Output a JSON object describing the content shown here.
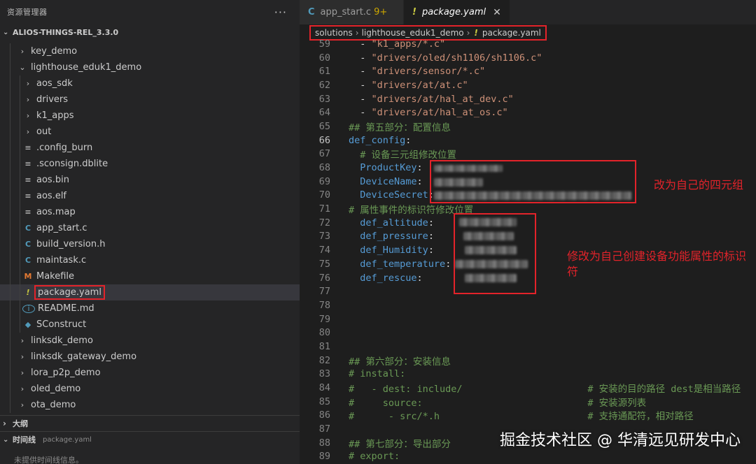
{
  "sidebar": {
    "title": "资源管理器",
    "more": "···",
    "project": "ALIOS-THINGS-REL_3.3.0",
    "tree": [
      {
        "label": "key_demo",
        "icon": "chevron-right",
        "indent": 1
      },
      {
        "label": "lighthouse_eduk1_demo",
        "icon": "chevron-down",
        "indent": 1
      },
      {
        "label": "aos_sdk",
        "icon": "chevron-right",
        "indent": 2
      },
      {
        "label": "drivers",
        "icon": "chevron-right",
        "indent": 2
      },
      {
        "label": "k1_apps",
        "icon": "chevron-right",
        "indent": 2
      },
      {
        "label": "out",
        "icon": "chevron-right",
        "indent": 2
      },
      {
        "label": ".config_burn",
        "icon": "lines",
        "indent": 2
      },
      {
        "label": ".sconsign.dblite",
        "icon": "lines",
        "indent": 2
      },
      {
        "label": "aos.bin",
        "icon": "lines",
        "indent": 2
      },
      {
        "label": "aos.elf",
        "icon": "lines",
        "indent": 2
      },
      {
        "label": "aos.map",
        "icon": "lines",
        "indent": 2
      },
      {
        "label": "app_start.c",
        "icon": "c",
        "indent": 2
      },
      {
        "label": "build_version.h",
        "icon": "c",
        "indent": 2
      },
      {
        "label": "maintask.c",
        "icon": "c",
        "indent": 2
      },
      {
        "label": "Makefile",
        "icon": "m",
        "indent": 2
      },
      {
        "label": "package.yaml",
        "icon": "exclaim",
        "indent": 2,
        "active": true
      },
      {
        "label": "README.md",
        "icon": "info",
        "indent": 2
      },
      {
        "label": "SConstruct",
        "icon": "s",
        "indent": 2
      },
      {
        "label": "linksdk_demo",
        "icon": "chevron-right",
        "indent": 1
      },
      {
        "label": "linksdk_gateway_demo",
        "icon": "chevron-right",
        "indent": 1
      },
      {
        "label": "lora_p2p_demo",
        "icon": "chevron-right",
        "indent": 1
      },
      {
        "label": "oled_demo",
        "icon": "chevron-right",
        "indent": 1
      },
      {
        "label": "ota_demo",
        "icon": "chevron-right",
        "indent": 1
      }
    ],
    "outline_label": "大纲",
    "timeline_label": "时间线",
    "timeline_file": "package.yaml",
    "timeline_empty": "未提供时间线信息。"
  },
  "tabs": [
    {
      "name": "app_start.c",
      "icon": "c",
      "modified": "9+",
      "active": false
    },
    {
      "name": "package.yaml",
      "icon": "exclaim",
      "active": true,
      "close": "✕"
    }
  ],
  "breadcrumb": [
    "solutions",
    "lighthouse_eduk1_demo",
    "package.yaml"
  ],
  "code_lines": [
    {
      "n": "59",
      "parts": [
        [
          "t",
          "  - "
        ],
        [
          "st",
          "\"k1_apps/*.c\""
        ]
      ]
    },
    {
      "n": "60",
      "parts": [
        [
          "t",
          "  - "
        ],
        [
          "st",
          "\"drivers/oled/sh1106/sh1106.c\""
        ]
      ]
    },
    {
      "n": "61",
      "parts": [
        [
          "t",
          "  - "
        ],
        [
          "st",
          "\"drivers/sensor/*.c\""
        ]
      ]
    },
    {
      "n": "62",
      "parts": [
        [
          "t",
          "  - "
        ],
        [
          "st",
          "\"drivers/at/at.c\""
        ]
      ]
    },
    {
      "n": "63",
      "parts": [
        [
          "t",
          "  - "
        ],
        [
          "st",
          "\"drivers/at/hal_at_dev.c\""
        ]
      ]
    },
    {
      "n": "64",
      "parts": [
        [
          "t",
          "  - "
        ],
        [
          "st",
          "\"drivers/at/hal_at_os.c\""
        ]
      ]
    },
    {
      "n": "65",
      "parts": [
        [
          "cm",
          "## 第五部分：配置信息"
        ]
      ]
    },
    {
      "n": "66",
      "parts": [
        [
          "ky",
          "def_config"
        ],
        [
          "t",
          ":"
        ]
      ],
      "current": true
    },
    {
      "n": "67",
      "parts": [
        [
          "cm",
          "  # 设备三元组修改位置"
        ]
      ]
    },
    {
      "n": "68",
      "parts": [
        [
          "t",
          "  "
        ],
        [
          "ky",
          "ProductKey"
        ],
        [
          "t",
          ":"
        ]
      ]
    },
    {
      "n": "69",
      "parts": [
        [
          "t",
          "  "
        ],
        [
          "ky",
          "DeviceName"
        ],
        [
          "t",
          ":"
        ]
      ]
    },
    {
      "n": "70",
      "parts": [
        [
          "t",
          "  "
        ],
        [
          "ky",
          "DeviceSecret"
        ],
        [
          "t",
          ":"
        ]
      ]
    },
    {
      "n": "71",
      "parts": [
        [
          "cm",
          "# 属性事件的标识符修改位置"
        ]
      ]
    },
    {
      "n": "72",
      "parts": [
        [
          "t",
          "  "
        ],
        [
          "ky",
          "def_altitude"
        ],
        [
          "t",
          ":"
        ]
      ]
    },
    {
      "n": "73",
      "parts": [
        [
          "t",
          "  "
        ],
        [
          "ky",
          "def_pressure"
        ],
        [
          "t",
          ":"
        ]
      ]
    },
    {
      "n": "74",
      "parts": [
        [
          "t",
          "  "
        ],
        [
          "ky",
          "def_Humidity"
        ],
        [
          "t",
          ":"
        ]
      ]
    },
    {
      "n": "75",
      "parts": [
        [
          "t",
          "  "
        ],
        [
          "ky",
          "def_temperature"
        ],
        [
          "t",
          ":"
        ]
      ]
    },
    {
      "n": "76",
      "parts": [
        [
          "t",
          "  "
        ],
        [
          "ky",
          "def_rescue"
        ],
        [
          "t",
          ":"
        ]
      ]
    },
    {
      "n": "77",
      "parts": []
    },
    {
      "n": "78",
      "parts": []
    },
    {
      "n": "79",
      "parts": []
    },
    {
      "n": "80",
      "parts": []
    },
    {
      "n": "81",
      "parts": []
    },
    {
      "n": "82",
      "parts": [
        [
          "cm",
          "## 第六部分：安装信息"
        ]
      ]
    },
    {
      "n": "83",
      "parts": [
        [
          "cm",
          "# install:"
        ]
      ]
    },
    {
      "n": "84",
      "parts": [
        [
          "cm",
          "#   - dest: include/                      # 安装的目的路径 dest是相当路径"
        ]
      ]
    },
    {
      "n": "85",
      "parts": [
        [
          "cm",
          "#     source:                             # 安装源列表"
        ]
      ]
    },
    {
      "n": "86",
      "parts": [
        [
          "cm",
          "#      - src/*.h                          # 支持通配符，相对路径"
        ]
      ]
    },
    {
      "n": "87",
      "parts": []
    },
    {
      "n": "88",
      "parts": [
        [
          "cm",
          "## 第七部分：导出部分"
        ]
      ]
    },
    {
      "n": "89",
      "parts": [
        [
          "cm",
          "# export:"
        ]
      ]
    }
  ],
  "annotations": {
    "note1": "改为自己的四元组",
    "note2": "修改为自己创建设备功能属性的标识符"
  },
  "watermark": "掘金技术社区 @ 华清远见研发中心"
}
